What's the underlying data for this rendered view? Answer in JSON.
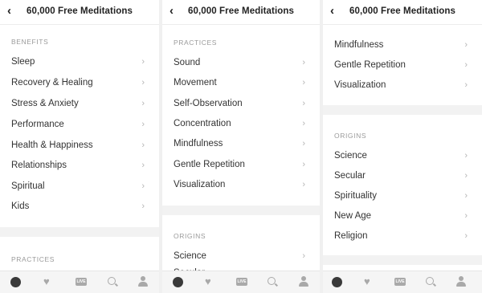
{
  "app": {
    "title": "60,000 Free Meditations",
    "back_icon": "chevron-left-icon"
  },
  "screens": [
    {
      "sections": [
        {
          "header": "BENEFITS",
          "items": [
            "Sleep",
            "Recovery & Healing",
            "Stress & Anxiety",
            "Performance",
            "Health & Happiness",
            "Relationships",
            "Spiritual",
            "Kids"
          ]
        },
        {
          "header": "PRACTICES",
          "items": []
        }
      ]
    },
    {
      "sections": [
        {
          "header": "PRACTICES",
          "items": [
            "Sound",
            "Movement",
            "Self-Observation",
            "Concentration",
            "Mindfulness",
            "Gentle Repetition",
            "Visualization"
          ]
        },
        {
          "header": "ORIGINS",
          "items": [
            "Science",
            "Secular"
          ]
        }
      ]
    },
    {
      "sections": [
        {
          "header": "",
          "items": [
            "Mindfulness",
            "Gentle Repetition",
            "Visualization"
          ]
        },
        {
          "header": "ORIGINS",
          "items": [
            "Science",
            "Secular",
            "Spirituality",
            "New Age",
            "Religion"
          ]
        }
      ]
    }
  ],
  "tabbar": {
    "tabs": [
      {
        "icon": "globe-icon",
        "active": true
      },
      {
        "icon": "heart-icon",
        "active": false
      },
      {
        "icon": "live-icon",
        "label": "LIVE",
        "active": false
      },
      {
        "icon": "search-icon",
        "active": false
      },
      {
        "icon": "profile-icon",
        "active": false
      }
    ]
  },
  "colors": {
    "active_icon": "#3a3a3a",
    "inactive_icon": "#a9a9a9",
    "section_header": "#9a9a9a",
    "chevron": "#b5b5b5"
  }
}
